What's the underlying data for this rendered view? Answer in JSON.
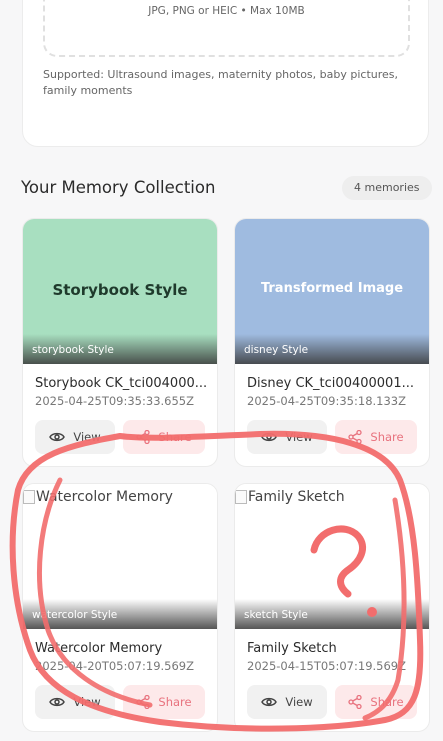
{
  "upload": {
    "hint": "JPG, PNG or HEIC • Max 10MB",
    "supported": "Supported: Ultrasound images, maternity photos, baby pictures, family moments"
  },
  "collection": {
    "title": "Your Memory Collection",
    "count": "4 memories"
  },
  "cards": [
    {
      "image_text": "Storybook Style",
      "image_bg": "#a8dfc0",
      "style_label": "storybook Style",
      "title": "Storybook CK_tci004000...",
      "date": "2025-04-25T09:35:33.655Z",
      "view": "View",
      "share": "Share"
    },
    {
      "image_text": "Transformed Image",
      "image_bg": "#9fbbe0",
      "style_label": "disney Style",
      "title": "Disney CK_tci00400001...",
      "date": "2025-04-25T09:35:18.133Z",
      "view": "View",
      "share": "Share"
    },
    {
      "image_alt": "Watercolor Memory",
      "style_label": "watercolor Style",
      "title": "Watercolor Memory",
      "date": "2025-04-20T05:07:19.569Z",
      "view": "View",
      "share": "Share"
    },
    {
      "image_alt": "Family Sketch",
      "style_label": "sketch Style",
      "title": "Family Sketch",
      "date": "2025-04-15T05:07:19.569Z",
      "view": "View",
      "share": "Share"
    }
  ],
  "annotation": {
    "mark": "?",
    "color": "#f26d6d"
  },
  "colors": {
    "share_text": "#e8727e",
    "share_bg": "#fde9ea"
  }
}
